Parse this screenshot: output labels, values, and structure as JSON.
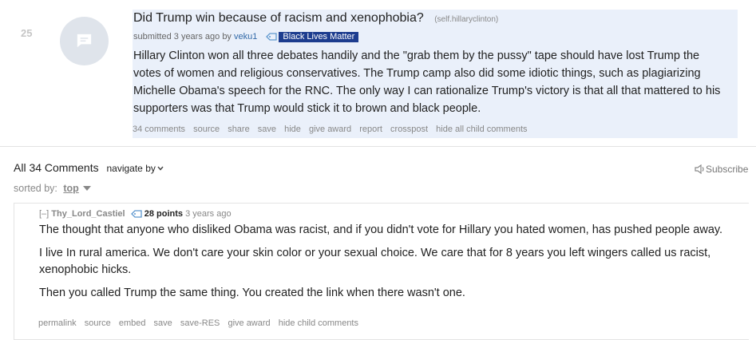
{
  "post": {
    "score": "25",
    "title": "Did Trump win because of racism and xenophobia?",
    "domain": "(self.hillaryclinton)",
    "submitted_prefix": "submitted",
    "time": "3 years ago",
    "by": "by",
    "author": "veku1",
    "flair": "Black Lives Matter",
    "selftext": "Hillary Clinton won all three debates handily and the \"grab them by the pussy\" tape should have lost Trump the votes of women and religious conservatives. The Trump camp also did some idiotic things, such as plagiarizing Michelle Obama's speech for the RNC. The only way I can rationalize Trump's victory is that all that mattered to his supporters was that Trump would stick it to brown and black people.",
    "buttons": {
      "comments": "34 comments",
      "source": "source",
      "share": "share",
      "save": "save",
      "hide": "hide",
      "give_award": "give award",
      "report": "report",
      "crosspost": "crosspost",
      "hide_all": "hide all child comments"
    }
  },
  "comments_area": {
    "heading": "All 34 Comments",
    "navigate_by": "navigate by",
    "subscribe": "Subscribe",
    "sorted_by": "sorted by:",
    "sort_value": "top"
  },
  "comment": {
    "collapse": "[–]",
    "author": "Thy_Lord_Castiel",
    "points": "28 points",
    "time": "3 years ago",
    "paragraphs": [
      "The thought that anyone who disliked Obama was racist, and if you didn't vote for Hillary you hated women, has pushed people away.",
      "I live In rural america. We don't care your skin color or your sexual choice. We care that for 8 years you left wingers called us racist, xenophobic hicks.",
      "Then you called Trump the same thing. You created the link when there wasn't one."
    ],
    "buttons": {
      "permalink": "permalink",
      "source": "source",
      "embed": "embed",
      "save": "save",
      "save_res": "save-RES",
      "give_award": "give award",
      "hide_child": "hide child comments"
    }
  },
  "colors": {
    "post_bg": "#eaf0fa",
    "flair_bg": "#1d3d8f",
    "author_link": "#336aa8"
  },
  "icons": {
    "thumbnail": "chat-bubble-icon",
    "flair": "tag-icon",
    "subscribe": "speaker-icon",
    "sort": "caret-down-icon"
  }
}
